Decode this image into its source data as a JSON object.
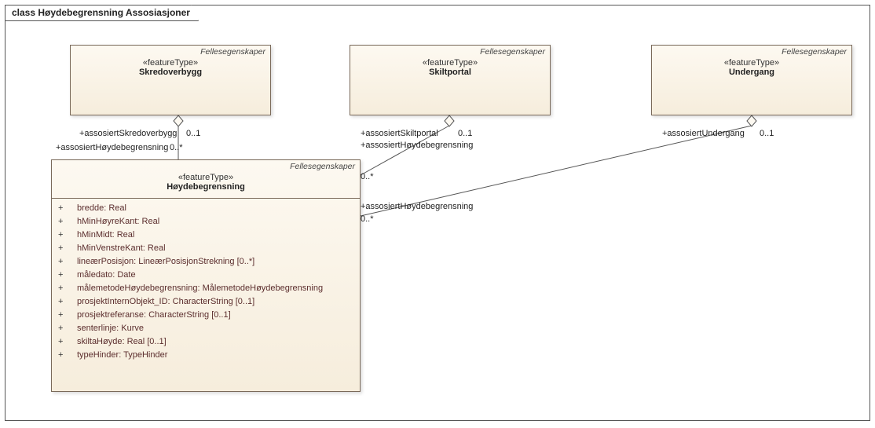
{
  "frame_title": "class Høydebegrensning Assosiasjoner",
  "common_label": "Fellesegenskaper",
  "stereotype": "«featureType»",
  "classes": {
    "skredoverbygg": "Skredoverbygg",
    "skiltportal": "Skiltportal",
    "undergang": "Undergang",
    "hoydebegrensning": "Høydebegrensning"
  },
  "attrs": [
    "bredde: Real",
    "hMinHøyreKant: Real",
    "hMinMidt: Real",
    "hMinVenstreKant: Real",
    "lineærPosisjon: LineærPosisjonStrekning [0..*]",
    "måledato: Date",
    "målemetodeHøydebegrensning: MålemetodeHøydebegrensning",
    "prosjektInternObjekt_ID: CharacterString [0..1]",
    "prosjektreferanse: CharacterString [0..1]",
    "senterlinje: Kurve",
    "skiltaHøyde: Real [0..1]",
    "typeHinder: TypeHinder"
  ],
  "assoc": {
    "skredEnd": "+assosiertSkredoverbygg",
    "skiltEnd": "+assosiertSkiltportal",
    "underEnd": "+assosiertUndergang",
    "hEnd": "+assosiertHøydebegrensning",
    "m01": "0..1",
    "m0s": "0..*"
  }
}
